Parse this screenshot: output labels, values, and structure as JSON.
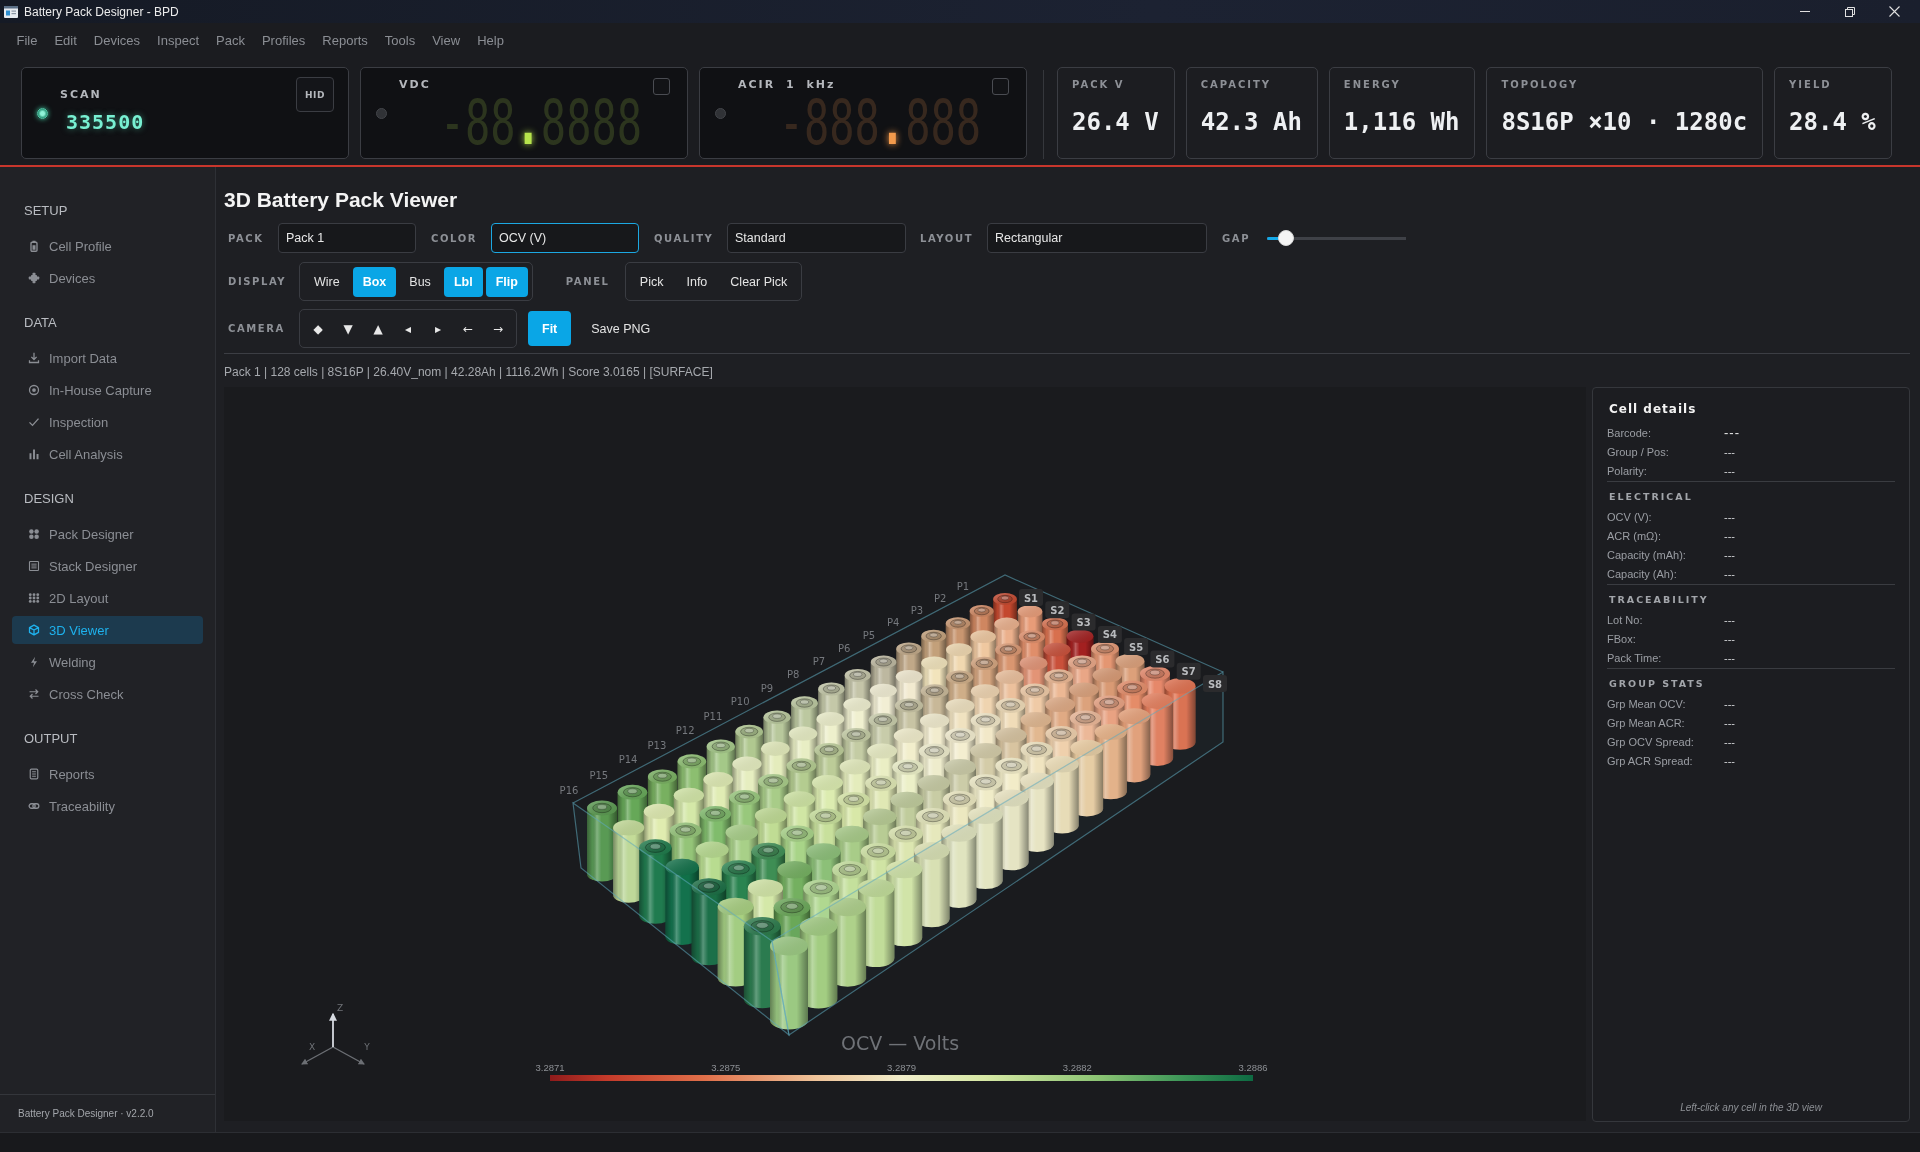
{
  "window": {
    "title": "Battery Pack Designer - BPD"
  },
  "menu": [
    "File",
    "Edit",
    "Devices",
    "Inspect",
    "Pack",
    "Profiles",
    "Reports",
    "Tools",
    "View",
    "Help"
  ],
  "instruments": [
    {
      "kind": "scanner",
      "label": "SCAN",
      "value": "335500",
      "button": "HID",
      "led_on": true
    },
    {
      "kind": "meter",
      "label": "VDC",
      "readout": "-88.8888",
      "color": "#b6e34c",
      "led_on": false,
      "checked": false
    },
    {
      "kind": "meter",
      "label": "ACIR 1 kHz",
      "readout": "-888.888",
      "color": "#f39a4c",
      "led_on": false,
      "checked": false
    }
  ],
  "summary": [
    {
      "label": "PACK V",
      "value": "26.4 V"
    },
    {
      "label": "CAPACITY",
      "value": "42.3 Ah"
    },
    {
      "label": "ENERGY",
      "value": "1,116 Wh"
    },
    {
      "label": "TOPOLOGY",
      "value": "8S16P ×10 · 1280c"
    },
    {
      "label": "YIELD",
      "value": "28.4 %"
    }
  ],
  "sidebar": {
    "sections": [
      {
        "title": "SETUP",
        "items": [
          {
            "label": "Cell Profile",
            "selected": false
          },
          {
            "label": "Devices",
            "selected": false
          }
        ]
      },
      {
        "title": "DATA",
        "items": [
          {
            "label": "Import Data",
            "selected": false
          },
          {
            "label": "In-House Capture",
            "selected": false
          },
          {
            "label": "Inspection",
            "selected": false
          },
          {
            "label": "Cell Analysis",
            "selected": false
          }
        ]
      },
      {
        "title": "DESIGN",
        "items": [
          {
            "label": "Pack Designer",
            "selected": false
          },
          {
            "label": "Stack Designer",
            "selected": false
          },
          {
            "label": "2D Layout",
            "selected": false
          },
          {
            "label": "3D Viewer",
            "selected": true
          },
          {
            "label": "Welding",
            "selected": false
          },
          {
            "label": "Cross Check",
            "selected": false
          }
        ]
      },
      {
        "title": "OUTPUT",
        "items": [
          {
            "label": "Reports",
            "selected": false
          },
          {
            "label": "Traceability",
            "selected": false
          }
        ]
      }
    ],
    "footer": "Battery Pack Designer · v2.2.0"
  },
  "viewer": {
    "title": "3D Battery Pack Viewer",
    "fields": [
      {
        "label": "PACK",
        "value": "Pack 1",
        "focused": false
      },
      {
        "label": "COLOR",
        "value": "OCV (V)",
        "focused": true
      },
      {
        "label": "QUALITY",
        "value": "Standard",
        "focused": false
      },
      {
        "label": "LAYOUT",
        "value": "Rectangular",
        "focused": false
      }
    ],
    "gap": {
      "label": "GAP",
      "level": 0.14
    },
    "display": {
      "label": "DISPLAY",
      "toggles": [
        {
          "label": "Wire",
          "on": false
        },
        {
          "label": "Box",
          "on": true
        },
        {
          "label": "Bus",
          "on": false
        },
        {
          "label": "Lbl",
          "on": true
        },
        {
          "label": "Flip",
          "on": true
        }
      ]
    },
    "panel": {
      "label": "PANEL",
      "toggles": [
        {
          "label": "Pick",
          "on": false
        },
        {
          "label": "Info",
          "on": false
        },
        {
          "label": "Clear Pick",
          "on": false
        }
      ]
    },
    "camera": {
      "label": "CAMERA",
      "views": [
        "◆",
        "▼",
        "▲",
        "◂",
        "▸",
        "←",
        "→"
      ],
      "actions": [
        {
          "label": "Fit",
          "kind": "primary"
        },
        {
          "label": "Save PNG",
          "kind": "plain"
        }
      ]
    },
    "info": "Pack 1 | 128 cells | 8S16P | 26.40V_nom | 42.28Ah | 1116.2Wh | Score 3.0165 | [SURFACE]",
    "scene": {
      "rows": [
        {
          "label": "P1",
          "cells": [
            {
              "color": "#c4482e"
            },
            {
              "color": "#e89c78"
            },
            {
              "color": "#d8704e"
            },
            {
              "color": "#a32020"
            },
            {
              "color": "#e49672"
            },
            {
              "color": "#dca07a"
            },
            {
              "color": "#e6886a"
            },
            {
              "color": "#e2714f"
            }
          ]
        },
        {
          "label": "P2",
          "cells": [
            {
              "color": "#cf8660"
            },
            {
              "color": "#ebb08c"
            },
            {
              "color": "#e08e6a"
            },
            {
              "color": "#c9503a"
            },
            {
              "color": "#e9a686"
            },
            {
              "color": "#d99a74"
            },
            {
              "color": "#e58c68"
            },
            {
              "color": "#e8805e"
            }
          ]
        },
        {
          "label": "P3",
          "cells": [
            {
              "color": "#c99670"
            },
            {
              "color": "#efc8a0"
            },
            {
              "color": "#d99670"
            },
            {
              "color": "#e39476"
            },
            {
              "color": "#ecb894"
            },
            {
              "color": "#dca27c"
            },
            {
              "color": "#e9a282"
            },
            {
              "color": "#e9a27a"
            }
          ]
        },
        {
          "label": "P4",
          "cells": [
            {
              "color": "#c3a07a"
            },
            {
              "color": "#f0d8b0"
            },
            {
              "color": "#d4a47e"
            },
            {
              "color": "#ecc09c"
            },
            {
              "color": "#efcaa6"
            },
            {
              "color": "#e0aa84"
            },
            {
              "color": "#ecb898"
            },
            {
              "color": "#ebb488"
            }
          ]
        },
        {
          "label": "P5",
          "cells": [
            {
              "color": "#c0a888"
            },
            {
              "color": "#f2e4bc"
            },
            {
              "color": "#cfae88"
            },
            {
              "color": "#efd4b0"
            },
            {
              "color": "#f0dcb8"
            },
            {
              "color": "#e2b890"
            },
            {
              "color": "#efd0ac"
            },
            {
              "color": "#efd0a4"
            }
          ]
        },
        {
          "label": "P6",
          "cells": [
            {
              "color": "#bdb8a0"
            },
            {
              "color": "#f2ead0"
            },
            {
              "color": "#c8b898"
            },
            {
              "color": "#f0e2c0"
            },
            {
              "color": "#f2e8c8"
            },
            {
              "color": "#d8c4a0"
            },
            {
              "color": "#f0e4c0"
            },
            {
              "color": "#f0e0b8"
            }
          ]
        },
        {
          "label": "P7",
          "cells": [
            {
              "color": "#c4c4a8"
            },
            {
              "color": "#f2eed4"
            },
            {
              "color": "#c8c4a4"
            },
            {
              "color": "#f2ecce"
            },
            {
              "color": "#f4eed0"
            },
            {
              "color": "#d4cca8"
            },
            {
              "color": "#f2ecc8"
            },
            {
              "color": "#f0e8c4"
            }
          ]
        },
        {
          "label": "P8",
          "cells": [
            {
              "color": "#c4c8a8"
            },
            {
              "color": "#f0f0d0"
            },
            {
              "color": "#c8ccaa"
            },
            {
              "color": "#f2eecc"
            },
            {
              "color": "#eeeccc"
            },
            {
              "color": "#cccca8"
            },
            {
              "color": "#f0ecc8"
            },
            {
              "color": "#eee8c4"
            }
          ]
        },
        {
          "label": "P9",
          "cells": [
            {
              "color": "#bcc8a0"
            },
            {
              "color": "#eef0cc"
            },
            {
              "color": "#c4cca4"
            },
            {
              "color": "#eaeec4"
            },
            {
              "color": "#ecf0c8"
            },
            {
              "color": "#c8cca4"
            },
            {
              "color": "#ece8c0"
            },
            {
              "color": "#ebe9c2"
            }
          ]
        },
        {
          "label": "P10",
          "cells": [
            {
              "color": "#b8c89c"
            },
            {
              "color": "#e8eec4"
            },
            {
              "color": "#bccc98"
            },
            {
              "color": "#e4ecbc"
            },
            {
              "color": "#e0e8b4"
            },
            {
              "color": "#c0cc9c"
            },
            {
              "color": "#e6e8bc"
            },
            {
              "color": "#e8e8c0"
            }
          ]
        },
        {
          "label": "P11",
          "cells": [
            {
              "color": "#b0c890"
            },
            {
              "color": "#e4ecbc"
            },
            {
              "color": "#b4cc90"
            },
            {
              "color": "#dcecb0"
            },
            {
              "color": "#d8e8a8"
            },
            {
              "color": "#b8cc94"
            },
            {
              "color": "#dce6b0"
            },
            {
              "color": "#e0e4b4"
            }
          ]
        },
        {
          "label": "P12",
          "cells": [
            {
              "color": "#a4c888"
            },
            {
              "color": "#e6eec0"
            },
            {
              "color": "#a8cc88"
            },
            {
              "color": "#d0e6a4"
            },
            {
              "color": "#c8e09c"
            },
            {
              "color": "#a8cc88"
            },
            {
              "color": "#d0e4a4"
            },
            {
              "color": "#d8e8a8"
            }
          ]
        },
        {
          "label": "P13",
          "cells": [
            {
              "color": "#8cbe70"
            },
            {
              "color": "#e0ecb4"
            },
            {
              "color": "#98c87c"
            },
            {
              "color": "#c0dc94"
            },
            {
              "color": "#a8d488"
            },
            {
              "color": "#8cc078"
            },
            {
              "color": "#c4e09c"
            },
            {
              "color": "#c8e098"
            }
          ]
        },
        {
          "label": "P14",
          "cells": [
            {
              "color": "#78b060"
            },
            {
              "color": "#d4e8a8"
            },
            {
              "color": "#80bc6c"
            },
            {
              "color": "#a8d088"
            },
            {
              "color": "#3e8e54"
            },
            {
              "color": "#74b060"
            },
            {
              "color": "#b0d890"
            },
            {
              "color": "#b4d488"
            }
          ]
        },
        {
          "label": "P15",
          "cells": [
            {
              "color": "#66a858"
            },
            {
              "color": "#e0ecb0"
            },
            {
              "color": "#94c478"
            },
            {
              "color": "#b8dc90"
            },
            {
              "color": "#2a8450"
            },
            {
              "color": "#d4e8a8"
            },
            {
              "color": "#6aa858"
            },
            {
              "color": "#a8d080"
            }
          ]
        },
        {
          "label": "P16",
          "cells": [
            {
              "color": "#5a9a50"
            },
            {
              "color": "#c4dc98"
            },
            {
              "color": "#1e7a4a"
            },
            {
              "color": "#107048"
            },
            {
              "color": "#1a6e44"
            },
            {
              "color": "#a8d080"
            },
            {
              "color": "#2a7a4a"
            },
            {
              "color": "#a0cc80"
            }
          ]
        }
      ],
      "series_labels": [
        "S1",
        "S2",
        "S3",
        "S4",
        "S5",
        "S6",
        "S7",
        "S8"
      ],
      "axes": [
        "Z",
        "X",
        "Y"
      ],
      "color_scale": {
        "title": "OCV — Volts",
        "ticks": [
          "3.2871",
          "3.2875",
          "3.2879",
          "3.2882",
          "3.2886"
        ]
      }
    }
  },
  "details": {
    "title": "Cell details",
    "sections": [
      {
        "rows": [
          {
            "label": "Barcode:",
            "value": "---"
          },
          {
            "label": "Group / Pos:",
            "value": "---"
          },
          {
            "label": "Polarity:",
            "value": "---"
          }
        ]
      },
      {
        "title": "ELECTRICAL",
        "rows": [
          {
            "label": "OCV (V):",
            "value": "---"
          },
          {
            "label": "ACR (mΩ):",
            "value": "---"
          },
          {
            "label": "Capacity (mAh):",
            "value": "---"
          },
          {
            "label": "Capacity (Ah):",
            "value": "---"
          }
        ]
      },
      {
        "title": "TRACEABILITY",
        "rows": [
          {
            "label": "Lot No:",
            "value": "---"
          },
          {
            "label": "FBox:",
            "value": "---"
          },
          {
            "label": "Pack Time:",
            "value": "---"
          }
        ]
      },
      {
        "title": "GROUP STATS",
        "rows": [
          {
            "label": "Grp Mean OCV:",
            "value": "---"
          },
          {
            "label": "Grp Mean ACR:",
            "value": "---"
          },
          {
            "label": "Grp OCV Spread:",
            "value": "---"
          },
          {
            "label": "Grp ACR Spread:",
            "value": "---"
          }
        ]
      }
    ],
    "hint": "Left-click any cell in the 3D view"
  }
}
